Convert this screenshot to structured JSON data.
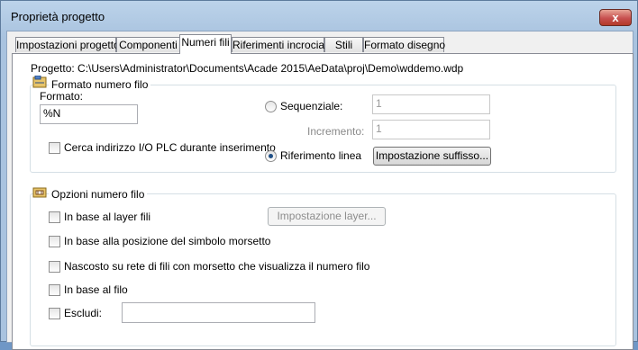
{
  "window": {
    "title": "Proprietà progetto",
    "close_glyph": "x"
  },
  "tabs": [
    {
      "label": "Impostazioni progetto"
    },
    {
      "label": "Componenti"
    },
    {
      "label": "Numeri fili"
    },
    {
      "label": "Riferimenti incrociati"
    },
    {
      "label": "Stili"
    },
    {
      "label": "Formato disegno"
    }
  ],
  "active_tab": "Numeri fili",
  "project_path": "Progetto: C:\\Users\\Administrator\\Documents\\Acade 2015\\AeData\\proj\\Demo\\wddemo.wdp",
  "wire_format_group": {
    "title": "Formato numero filo",
    "icon": "wire-format-icon",
    "format_label": "Formato:",
    "format_value": "%N",
    "plc_search_label": "Cerca indirizzo I/O PLC durante inserimento",
    "plc_search_checked": false,
    "sequential_label": "Sequenziale:",
    "sequential_selected": false,
    "sequential_value": "1",
    "increment_label": "Incremento:",
    "increment_value": "1",
    "line_reference_label": "Riferimento linea",
    "line_reference_selected": true,
    "suffix_button_label": "Impostazione suffisso..."
  },
  "wire_options_group": {
    "title": "Opzioni numero filo",
    "icon": "wire-options-icon",
    "by_layer_label": "In base al layer fili",
    "by_layer_checked": false,
    "layer_button_label": "Impostazione layer...",
    "by_terminal_label": "In base alla posizione del simbolo morsetto",
    "by_terminal_checked": false,
    "hidden_label": "Nascosto su rete di fili con morsetto che visualizza il numero filo",
    "hidden_checked": false,
    "by_wire_label": "In base al filo",
    "by_wire_checked": false,
    "exclude_label": "Escludi:",
    "exclude_checked": false,
    "exclude_value": ""
  }
}
